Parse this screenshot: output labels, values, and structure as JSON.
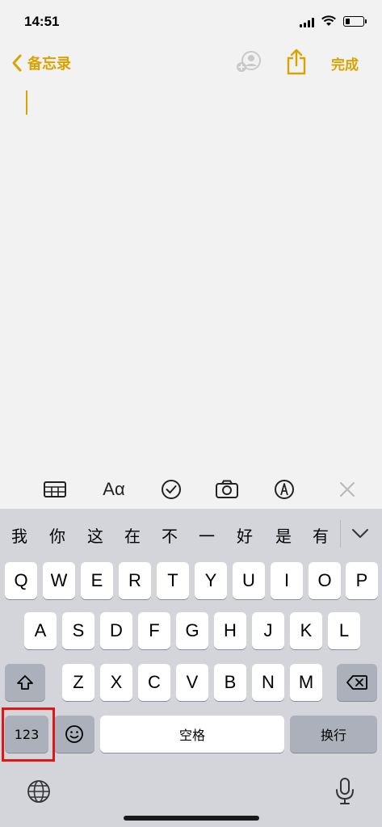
{
  "status_bar": {
    "time": "14:51"
  },
  "nav": {
    "back_label": "备忘录",
    "done_label": "完成"
  },
  "format_toolbar": {
    "text_style_label": "Aα"
  },
  "keyboard": {
    "candidates": [
      "我",
      "你",
      "这",
      "在",
      "不",
      "一",
      "好",
      "是",
      "有"
    ],
    "row1": [
      "Q",
      "W",
      "E",
      "R",
      "T",
      "Y",
      "U",
      "I",
      "O",
      "P"
    ],
    "row2": [
      "A",
      "S",
      "D",
      "F",
      "G",
      "H",
      "J",
      "K",
      "L"
    ],
    "row3": [
      "Z",
      "X",
      "C",
      "V",
      "B",
      "N",
      "M"
    ],
    "numbers_key": "123",
    "space_key": "空格",
    "return_key": "换行"
  },
  "colors": {
    "accent": "#d9a300",
    "highlight": "#e01616"
  }
}
